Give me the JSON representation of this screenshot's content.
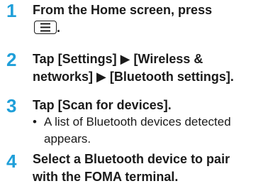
{
  "steps": [
    {
      "number": "1",
      "line1": "From the Home screen, press",
      "line2_suffix": ".",
      "key_icon": "menu-key-icon"
    },
    {
      "number": "2",
      "line1": "Tap [Settings] ▶ [Wireless &",
      "line2": "networks] ▶ [Bluetooth settings]."
    },
    {
      "number": "3",
      "line1": "Tap [Scan for devices].",
      "bullet": "•",
      "bullet_line1": "A list of Bluetooth devices detected",
      "bullet_line2": "appears."
    },
    {
      "number": "4",
      "line1": "Select a Bluetooth device to pair",
      "line2": "with the FOMA terminal."
    }
  ],
  "colors": {
    "step_number": "#1f9fd9",
    "text": "#1a1a1a"
  }
}
